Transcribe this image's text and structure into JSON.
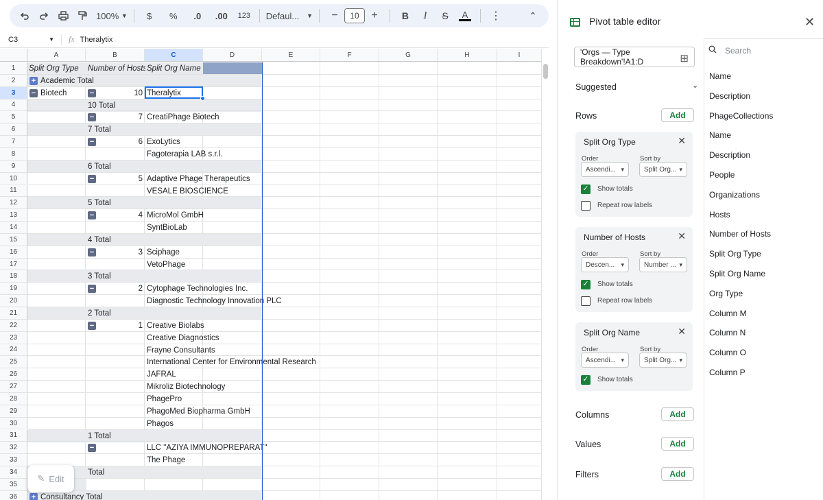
{
  "toolbar": {
    "undo_icon": "undo-icon",
    "redo_icon": "redo-icon",
    "zoom": "100%",
    "currency": "$",
    "percent": "%",
    "dec_decrease": ".0",
    "dec_increase": ".00",
    "number_format": "123",
    "font": "Defaul...",
    "font_size": "10",
    "bold": "B",
    "italic": "I",
    "strike": "S",
    "text_color": "A",
    "more": "⋮",
    "collapse": "⌃"
  },
  "formula_bar": {
    "cell_ref": "C3",
    "fx": "fx",
    "value": "Theralytix"
  },
  "columns": [
    "A",
    "B",
    "C",
    "D",
    "E",
    "F",
    "G",
    "H",
    "I"
  ],
  "rows": [
    {
      "n": "1",
      "a": "Split Org Type",
      "b": "Number of Hosts",
      "c": "Split Org Name",
      "type": "header"
    },
    {
      "n": "2",
      "a": "Academic Total",
      "a_toggle": "+",
      "type": "total"
    },
    {
      "n": "3",
      "a": "Biotech",
      "a_toggle": "−",
      "b": "10",
      "b_toggle": "−",
      "c": "Theralytix"
    },
    {
      "n": "4",
      "b": "10 Total",
      "type": "total"
    },
    {
      "n": "5",
      "b": "7",
      "b_toggle": "−",
      "c": "CreatiPhage Biotech"
    },
    {
      "n": "6",
      "b": "7 Total",
      "type": "total"
    },
    {
      "n": "7",
      "b": "6",
      "b_toggle": "−",
      "c": "ExoLytics"
    },
    {
      "n": "8",
      "c": "Fagoterapia LAB s.r.l."
    },
    {
      "n": "9",
      "b": "6 Total",
      "type": "total"
    },
    {
      "n": "10",
      "b": "5",
      "b_toggle": "−",
      "c": "Adaptive Phage Therapeutics"
    },
    {
      "n": "11",
      "c": "VESALE BIOSCIENCE"
    },
    {
      "n": "12",
      "b": "5 Total",
      "type": "total"
    },
    {
      "n": "13",
      "b": "4",
      "b_toggle": "−",
      "c": "MicroMol GmbH"
    },
    {
      "n": "14",
      "c": "SyntBioLab"
    },
    {
      "n": "15",
      "b": "4 Total",
      "type": "total"
    },
    {
      "n": "16",
      "b": "3",
      "b_toggle": "−",
      "c": "Sciphage"
    },
    {
      "n": "17",
      "c": "VetoPhage"
    },
    {
      "n": "18",
      "b": "3 Total",
      "type": "total"
    },
    {
      "n": "19",
      "b": "2",
      "b_toggle": "−",
      "c": "Cytophage Technologies Inc."
    },
    {
      "n": "20",
      "c": "Diagnostic Technology Innovation PLC"
    },
    {
      "n": "21",
      "b": "2 Total",
      "type": "total"
    },
    {
      "n": "22",
      "b": "1",
      "b_toggle": "−",
      "c": "Creative Biolabs"
    },
    {
      "n": "23",
      "c": "Creative Diagnostics"
    },
    {
      "n": "24",
      "c": "Frayne Consultants"
    },
    {
      "n": "25",
      "c": "International Center for Environmental Research"
    },
    {
      "n": "26",
      "c": "JAFRAL"
    },
    {
      "n": "27",
      "c": "Mikroliz Biotechnology"
    },
    {
      "n": "28",
      "c": "PhagePro"
    },
    {
      "n": "29",
      "c": "PhagoMed Biopharma GmbH"
    },
    {
      "n": "30",
      "c": "Phagos"
    },
    {
      "n": "31",
      "b": "1 Total",
      "type": "total"
    },
    {
      "n": "32",
      "b_toggle": "−",
      "c": "LLC \"AZIYA IMMUNOPREPARAT\""
    },
    {
      "n": "33",
      "c": "The Phage"
    },
    {
      "n": "34",
      "b": "Total",
      "type": "total"
    },
    {
      "n": "35",
      "type": "total"
    },
    {
      "n": "36",
      "a": "Consultancy Total",
      "a_toggle": "+",
      "type": "total"
    }
  ],
  "edit_button": "Edit",
  "panel": {
    "title": "Pivot table editor",
    "range": "'Orgs — Type Breakdown'!A1:D",
    "suggested": "Suggested",
    "rows_label": "Rows",
    "add": "Add",
    "order_label": "Order",
    "sortby_label": "Sort by",
    "show_totals": "Show totals",
    "repeat_labels": "Repeat row labels",
    "cards": [
      {
        "title": "Split Org Type",
        "order": "Ascendi...",
        "sortby": "Split Org..."
      },
      {
        "title": "Number of Hosts",
        "order": "Descen...",
        "sortby": "Number ..."
      },
      {
        "title": "Split Org Name",
        "order": "Ascendi...",
        "sortby": "Split Org..."
      }
    ],
    "columns_label": "Columns",
    "values_label": "Values",
    "filters_label": "Filters",
    "search_placeholder": "Search",
    "fields": [
      "Name",
      "Description",
      "PhageCollections",
      "Name",
      "Description",
      "People",
      "Organizations",
      "Hosts",
      "Number of Hosts",
      "Split Org Type",
      "Split Org Name",
      "Org Type",
      "Column M",
      "Column N",
      "Column O",
      "Column P"
    ]
  }
}
